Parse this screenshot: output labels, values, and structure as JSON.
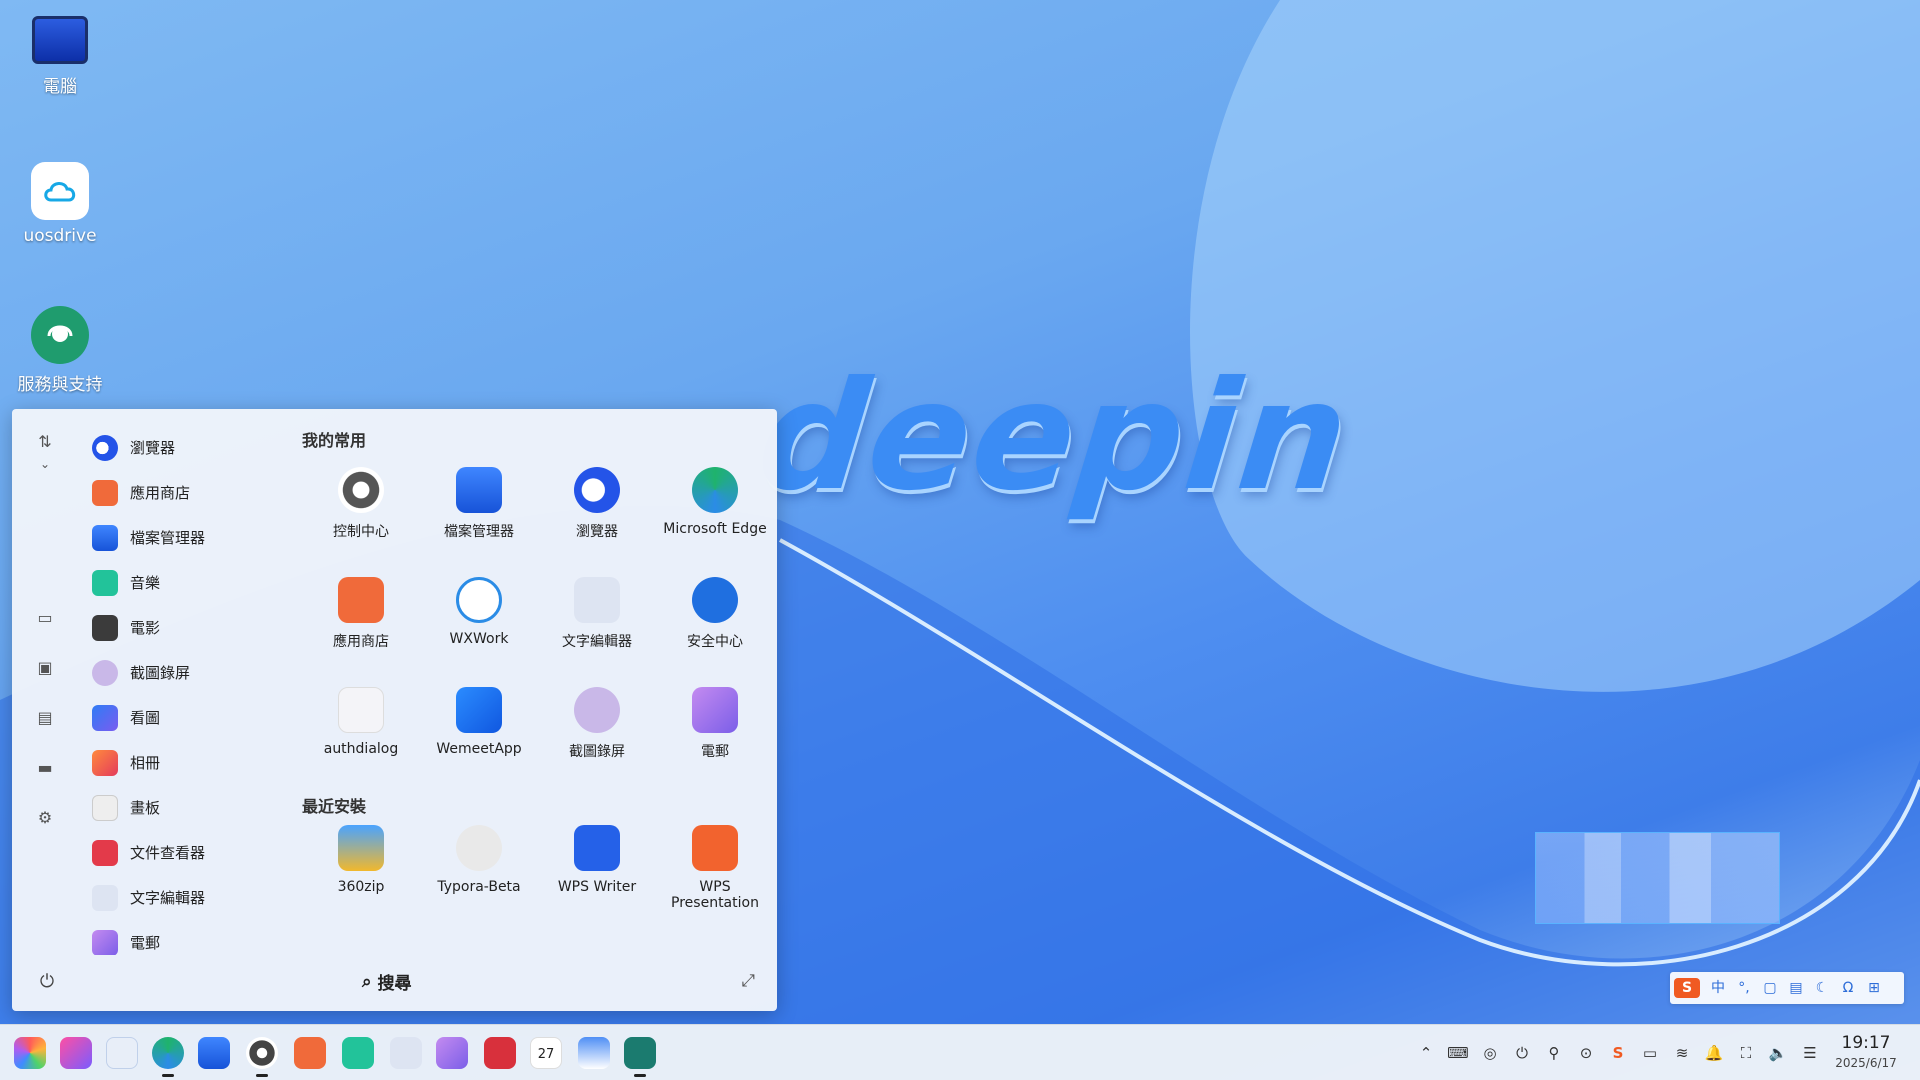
{
  "wallpaper": {
    "brand_text": "deepin"
  },
  "desktop": {
    "icons": [
      {
        "label": "電腦",
        "icon": "computer-icon"
      },
      {
        "label": "uosdrive",
        "icon": "cloud-drive-icon"
      },
      {
        "label": "服務與支持",
        "icon": "support-headset-icon"
      }
    ]
  },
  "launcher": {
    "sidebar_list": [
      {
        "label": "瀏覽器",
        "icon": "browser-icon"
      },
      {
        "label": "應用商店",
        "icon": "app-store-icon"
      },
      {
        "label": "檔案管理器",
        "icon": "file-manager-icon"
      },
      {
        "label": "音樂",
        "icon": "music-icon"
      },
      {
        "label": "電影",
        "icon": "movie-icon"
      },
      {
        "label": "截圖錄屏",
        "icon": "screenshot-icon"
      },
      {
        "label": "看圖",
        "icon": "image-viewer-icon"
      },
      {
        "label": "相冊",
        "icon": "album-icon"
      },
      {
        "label": "畫板",
        "icon": "draw-icon"
      },
      {
        "label": "文件查看器",
        "icon": "document-viewer-icon"
      },
      {
        "label": "文字編輯器",
        "icon": "text-editor-icon"
      },
      {
        "label": "電郵",
        "icon": "mail-icon"
      }
    ],
    "favorites_title": "我的常用",
    "favorites": [
      {
        "label": "控制中心",
        "icon": "control-center-icon"
      },
      {
        "label": "檔案管理器",
        "icon": "file-manager-icon"
      },
      {
        "label": "瀏覽器",
        "icon": "browser-icon"
      },
      {
        "label": "Microsoft Edge",
        "icon": "edge-icon"
      },
      {
        "label": "應用商店",
        "icon": "app-store-icon"
      },
      {
        "label": "WXWork",
        "icon": "wxwork-icon"
      },
      {
        "label": "文字編輯器",
        "icon": "text-editor-icon"
      },
      {
        "label": "安全中心",
        "icon": "security-center-icon"
      },
      {
        "label": "authdialog",
        "icon": "authdialog-icon"
      },
      {
        "label": "WemeetApp",
        "icon": "wemeet-icon"
      },
      {
        "label": "截圖錄屏",
        "icon": "screenshot-icon"
      },
      {
        "label": "電郵",
        "icon": "mail-icon"
      }
    ],
    "recent_title": "最近安裝",
    "recent": [
      {
        "label": "360zip",
        "icon": "zip-icon"
      },
      {
        "label": "Typora-Beta",
        "icon": "typora-icon"
      },
      {
        "label": "WPS Writer",
        "icon": "wps-writer-icon"
      },
      {
        "label": "WPS Presentation",
        "icon": "wps-presentation-icon"
      }
    ],
    "search_label": "搜尋"
  },
  "ime": {
    "mode_label": "中"
  },
  "taskbar": {
    "clock": {
      "time": "19:17",
      "date": "2025/6/17"
    },
    "calendar_day": "27"
  },
  "colors": {
    "accent": "#2c6cd8",
    "launcher_bg": "#f0f4fa"
  }
}
